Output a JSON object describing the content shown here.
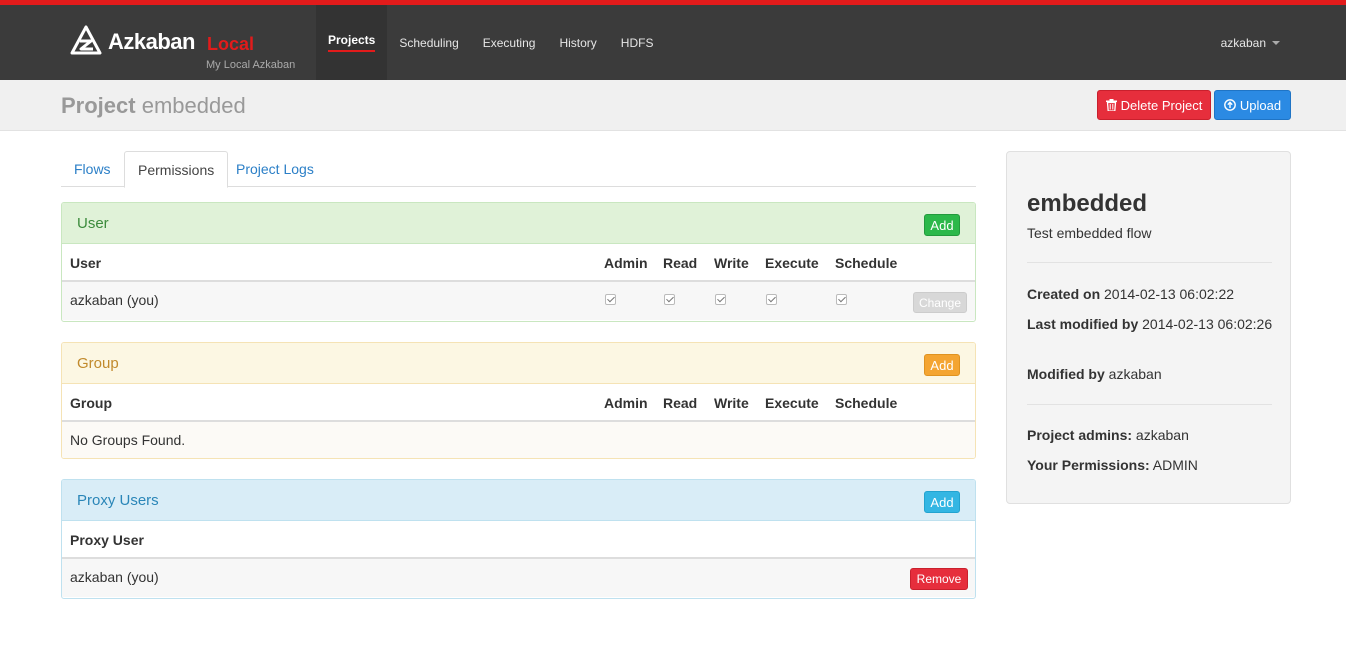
{
  "brand": {
    "name": "Azkaban",
    "env": "Local",
    "subtitle": "My Local Azkaban"
  },
  "nav": [
    {
      "label": "Projects",
      "active": true
    },
    {
      "label": "Scheduling"
    },
    {
      "label": "Executing"
    },
    {
      "label": "History"
    },
    {
      "label": "HDFS"
    }
  ],
  "user_menu": {
    "label": "azkaban"
  },
  "header": {
    "prefix": "Project",
    "project": "embedded",
    "delete_label": "Delete Project",
    "upload_label": "Upload"
  },
  "tabs": [
    {
      "label": "Flows"
    },
    {
      "label": "Permissions",
      "active": true
    },
    {
      "label": "Project Logs"
    }
  ],
  "columns": {
    "admin": "Admin",
    "read": "Read",
    "write": "Write",
    "execute": "Execute",
    "schedule": "Schedule"
  },
  "user_panel": {
    "title": "User",
    "add_label": "Add",
    "col_user": "User",
    "rows": [
      {
        "name": "azkaban (you)",
        "admin": true,
        "read": true,
        "write": true,
        "execute": true,
        "schedule": true,
        "action": "Change"
      }
    ]
  },
  "group_panel": {
    "title": "Group",
    "add_label": "Add",
    "col_group": "Group",
    "empty": "No Groups Found."
  },
  "proxy_panel": {
    "title": "Proxy Users",
    "add_label": "Add",
    "col_proxy": "Proxy User",
    "rows": [
      {
        "name": "azkaban (you)",
        "action": "Remove"
      }
    ]
  },
  "side": {
    "name": "embedded",
    "description": "Test embedded flow",
    "created_label": "Created on",
    "created_value": "2014-02-13 06:02:22",
    "modified_label": "Last modified by",
    "modified_value": "2014-02-13 06:02:26",
    "modified_by_label": "Modified by",
    "modified_by_value": "azkaban",
    "admins_label": "Project admins:",
    "admins_value": "azkaban",
    "perms_label": "Your Permissions:",
    "perms_value": "ADMIN"
  },
  "colors": {
    "accent_red": "#e21b1b",
    "topbar": "#3b3b3b",
    "link": "#2b7fc7"
  }
}
